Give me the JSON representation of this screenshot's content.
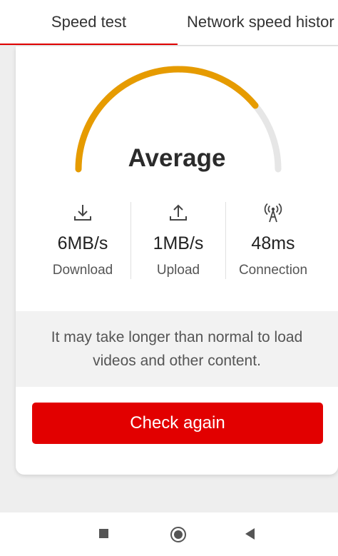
{
  "tabs": [
    {
      "label": "Speed test",
      "active": true
    },
    {
      "label": "Network speed histor",
      "active": false
    }
  ],
  "gauge": {
    "rating": "Average",
    "level_fraction": 0.78,
    "fill_color": "#e69b00",
    "track_color": "#e6e6e6"
  },
  "stats": [
    {
      "icon": "download-icon",
      "value": "6MB/s",
      "label": "Download"
    },
    {
      "icon": "upload-icon",
      "value": "1MB/s",
      "label": "Upload"
    },
    {
      "icon": "signal-tower-icon",
      "value": "48ms",
      "label": "Connection"
    }
  ],
  "notice": {
    "line1": "It may take longer than normal to load",
    "line2": "videos and other content."
  },
  "button": {
    "label": "Check again",
    "color": "#e20000"
  },
  "navbar": {
    "icons": [
      "recent-apps-icon",
      "home-icon",
      "back-icon"
    ]
  }
}
